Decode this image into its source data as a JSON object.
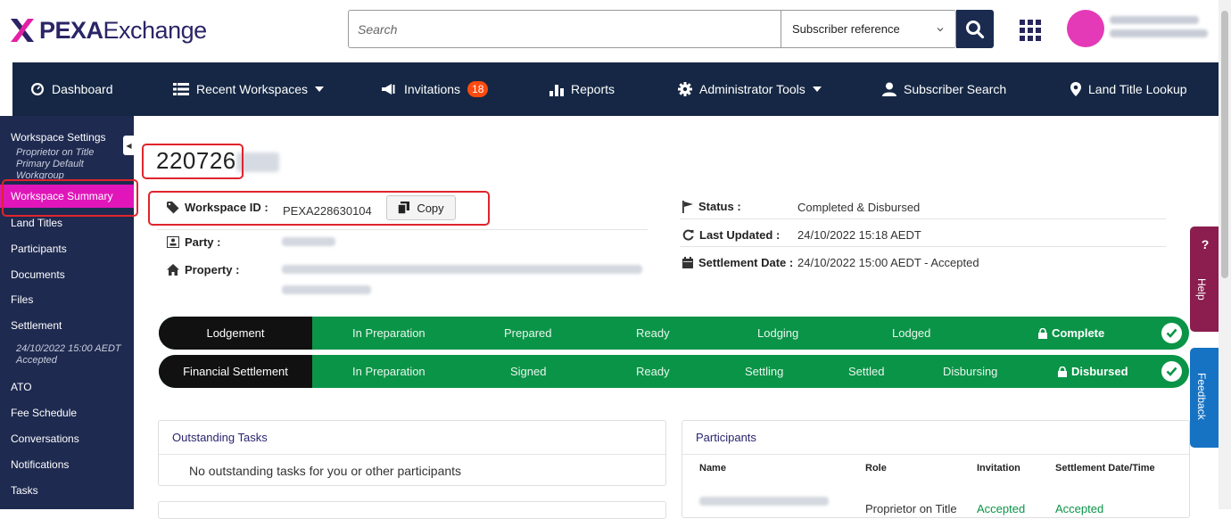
{
  "header": {
    "logo_bold": "PEXA",
    "logo_light": "Exchange",
    "search_placeholder": "Search",
    "search_scope": "Subscriber reference"
  },
  "nav": {
    "dashboard": "Dashboard",
    "recent_workspaces": "Recent Workspaces",
    "invitations": "Invitations",
    "invitations_count": "18",
    "reports": "Reports",
    "admin_tools": "Administrator Tools",
    "subscriber_search": "Subscriber Search",
    "land_title_lookup": "Land Title Lookup"
  },
  "sidebar": {
    "workspace_settings": "Workspace Settings",
    "settings_sub_1": "Proprietor on Title",
    "settings_sub_2": "Primary Default",
    "settings_sub_3": "Workgroup",
    "workspace_summary": "Workspace Summary",
    "land_titles": "Land Titles",
    "participants": "Participants",
    "documents": "Documents",
    "files": "Files",
    "settlement": "Settlement",
    "settlement_sub_1": "24/10/2022 15:00 AEDT",
    "settlement_sub_2": "Accepted",
    "ato": "ATO",
    "fee_schedule": "Fee Schedule",
    "conversations": "Conversations",
    "notifications": "Notifications",
    "tasks": "Tasks"
  },
  "workspace": {
    "title_number": "220726",
    "workspace_id_label": "Workspace ID :",
    "workspace_id": "PEXA228630104",
    "copy_label": "Copy",
    "party_label": "Party :",
    "property_label": "Property :",
    "status_label": "Status :",
    "status_value": "Completed & Disbursed",
    "last_updated_label": "Last Updated :",
    "last_updated_value": "24/10/2022 15:18 AEDT",
    "settlement_date_label": "Settlement Date :",
    "settlement_date_value": "24/10/2022 15:00 AEDT - Accepted"
  },
  "lodgement": {
    "head": "Lodgement",
    "steps": [
      "In Preparation",
      "Prepared",
      "Ready",
      "Lodging",
      "Lodged"
    ],
    "final": "Complete"
  },
  "financial": {
    "head": "Financial Settlement",
    "steps": [
      "In Preparation",
      "Signed",
      "Ready",
      "Settling",
      "Settled",
      "Disbursing"
    ],
    "final": "Disbursed"
  },
  "tasks_panel": {
    "title": "Outstanding Tasks",
    "empty": "No outstanding tasks for you or other participants"
  },
  "participants_panel": {
    "title": "Participants",
    "col_name": "Name",
    "col_role": "Role",
    "col_invitation": "Invitation",
    "col_settlement": "Settlement Date/Time",
    "row_role": "Proprietor on Title",
    "row_invitation": "Accepted",
    "row_settlement": "Accepted"
  },
  "side_tabs": {
    "help_glyph": "?",
    "help": "Help",
    "feedback": "Feedback"
  },
  "colors": {
    "nav_bg": "#152744",
    "sidebar_bg": "#1e2a50",
    "active_pink": "#e016ba",
    "progress_green": "#0a9447",
    "help_tab": "#8b1e4e",
    "feedback_tab": "#1673c4",
    "highlight_red": "#e0242c"
  }
}
